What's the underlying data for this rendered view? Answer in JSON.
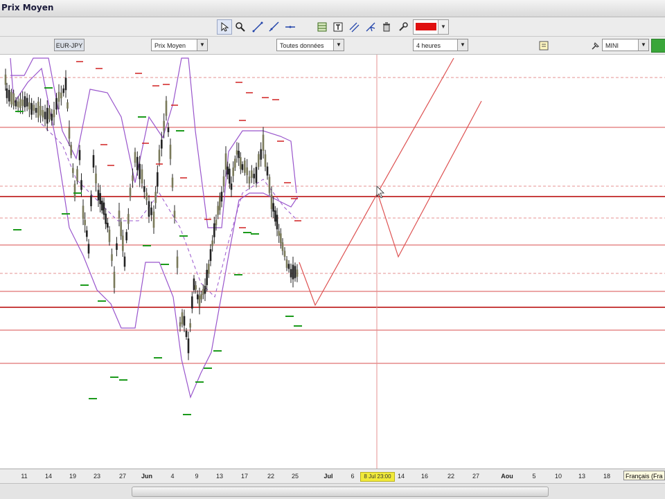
{
  "window": {
    "title": "Prix Moyen"
  },
  "toolbar": {
    "tools": [
      {
        "name": "pointer-tool-icon"
      },
      {
        "name": "zoom-tool-icon"
      },
      {
        "name": "trend-line-tool-icon"
      },
      {
        "name": "ray-line-tool-icon"
      },
      {
        "name": "horizontal-line-tool-icon"
      },
      {
        "name": "fibonacci-tool-icon"
      },
      {
        "name": "text-tool-icon"
      },
      {
        "name": "channel-tool-icon"
      },
      {
        "name": "pitchfork-tool-icon"
      },
      {
        "name": "delete-tool-icon"
      },
      {
        "name": "properties-tool-icon"
      }
    ],
    "line_color": "#e01010"
  },
  "selectors": {
    "pair": "EUR-JPY",
    "price_type": "Prix Moyen",
    "data_range": "Toutes données",
    "timeframe": "4 heures",
    "size": "MINI"
  },
  "axis": {
    "labels": [
      {
        "t": "11",
        "m": false
      },
      {
        "t": "14",
        "m": false
      },
      {
        "t": "19",
        "m": false
      },
      {
        "t": "23",
        "m": false
      },
      {
        "t": "27",
        "m": false
      },
      {
        "t": "Jun",
        "m": true
      },
      {
        "t": "4",
        "m": false
      },
      {
        "t": "9",
        "m": false
      },
      {
        "t": "13",
        "m": false
      },
      {
        "t": "17",
        "m": false
      },
      {
        "t": "22",
        "m": false
      },
      {
        "t": "25",
        "m": false
      },
      {
        "t": "Jul",
        "m": true
      },
      {
        "t": "6",
        "m": false
      },
      {
        "t": "14",
        "m": false
      },
      {
        "t": "16",
        "m": false
      },
      {
        "t": "22",
        "m": false
      },
      {
        "t": "27",
        "m": false
      },
      {
        "t": "Aou",
        "m": true
      },
      {
        "t": "5",
        "m": false
      },
      {
        "t": "10",
        "m": false
      },
      {
        "t": "13",
        "m": false
      },
      {
        "t": "18",
        "m": false
      }
    ],
    "cursor_date": "8 Jul 23:00",
    "language": "Français (Fra"
  },
  "colors": {
    "level_line": "#e07070",
    "envelope": "#9955cc",
    "candle": "#222222",
    "marker_green": "#1b9a1b",
    "marker_red": "#d02020"
  }
}
